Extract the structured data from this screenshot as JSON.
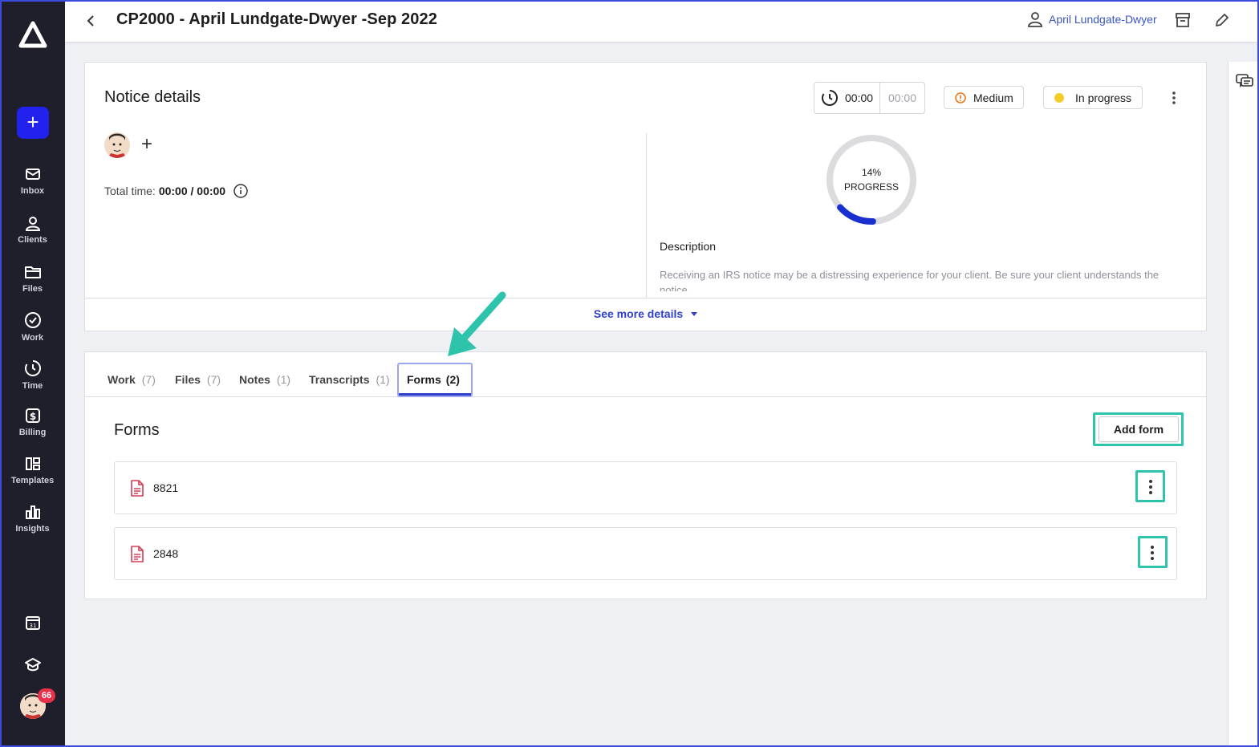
{
  "app": {
    "nav": [
      {
        "id": "inbox",
        "label": "Inbox",
        "icon": "mail-icon"
      },
      {
        "id": "clients",
        "label": "Clients",
        "icon": "users-icon"
      },
      {
        "id": "files",
        "label": "Files",
        "icon": "folder-icon"
      },
      {
        "id": "work",
        "label": "Work",
        "icon": "check-circle-icon"
      },
      {
        "id": "time",
        "label": "Time",
        "icon": "stopwatch-icon"
      },
      {
        "id": "billing",
        "label": "Billing",
        "icon": "dollar-icon"
      },
      {
        "id": "templates",
        "label": "Templates",
        "icon": "layout-icon"
      },
      {
        "id": "insights",
        "label": "Insights",
        "icon": "bar-chart-icon"
      }
    ],
    "new_button": "+",
    "notification_count": "66",
    "accent_color": "#2222ee",
    "sidebar_bg": "#1f1f2b"
  },
  "header": {
    "title": "CP2000 - April Lundgate-Dwyer -Sep 2022",
    "client_name": "April Lundgate-Dwyer"
  },
  "notice": {
    "title": "Notice details",
    "timer_running": "00:00",
    "timer_budget": "00:00",
    "priority": "Medium",
    "status": "In progress",
    "status_color": "#f2cd2a",
    "total_time_label": "Total time:",
    "total_time_value": "00:00 / 00:00",
    "progress_percent": "14%",
    "progress_value": 14,
    "progress_label": "PROGRESS",
    "description_heading": "Description",
    "description_text": "Receiving an IRS notice may be a distressing experience for your client. Be sure your client understands the notice.",
    "see_more": "See more details"
  },
  "tabs": [
    {
      "label": "Work",
      "count": "(7)"
    },
    {
      "label": "Files",
      "count": "(7)"
    },
    {
      "label": "Notes",
      "count": "(1)"
    },
    {
      "label": "Transcripts",
      "count": "(1)"
    },
    {
      "label": "Forms",
      "count": "(2)",
      "active": true
    }
  ],
  "forms": {
    "heading": "Forms",
    "add_button": "Add form",
    "items": [
      {
        "name": "8821"
      },
      {
        "name": "2848"
      }
    ]
  },
  "annotation_color": "#2ec4ac"
}
